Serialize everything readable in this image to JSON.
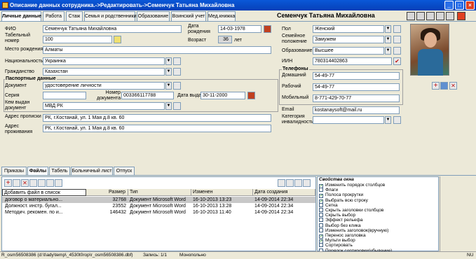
{
  "window": {
    "title": "Описание данных сотрудника.->Редактировать->Семенчук Татьяна Михайловна",
    "controls": [
      "_",
      "□",
      "×"
    ]
  },
  "tabs": [
    {
      "label": "Личные данные"
    },
    {
      "label": "Работа"
    },
    {
      "label": "Стаж"
    },
    {
      "label": "Семья и родственники"
    },
    {
      "label": "Образование"
    },
    {
      "label": "Воинский учет"
    },
    {
      "label": "Мед.книжка"
    }
  ],
  "header_name": "Семенчук Татьяна Михайловна",
  "form": {
    "fio_label": "ФИО",
    "fio_value": "Семенчук Татьяна Михайловна",
    "tabnum_label": "Табельный номер",
    "tabnum_value": "100",
    "birthplace_label": "Место рождения",
    "birthplace_value": "Алматы",
    "nationality_label": "Национальность",
    "nationality_value": "Украинка",
    "citizenship_label": "Гражданство",
    "citizenship_value": "Казахстан",
    "birthdate_label": "Дата рождения",
    "birthdate_value": "14-03-1978",
    "age_label": "Возраст",
    "age_value": "36",
    "age_unit": "лет",
    "passport": {
      "title": "Паспортные данные",
      "doc_label": "Документ",
      "doc_value": "удостоверение личности",
      "series_label": "Серия",
      "series_value": "",
      "number_label": "Номер документа",
      "number_value": "003366117788",
      "issue_label": "Дата выдачи",
      "issue_value": "30-11-2000",
      "issuer_label": "Кем выдан документ",
      "issuer_value": "МВД РК"
    },
    "reg_addr_label": "Адрес прописки",
    "reg_addr_value": "РК, г.Костанай, ул. 1 Мая д.8 кв. 60",
    "live_addr_label": "Адрес проживания",
    "live_addr_value": "РК, г.Костанай, ул. 1 Мая д.8 кв. 60",
    "sex_label": "Пол",
    "sex_value": "Женский",
    "marital_label": "Семейное положение",
    "marital_value": "Замужем",
    "education_label": "Образование",
    "education_value": "Высшее",
    "iin_label": "ИИН",
    "iin_value": "780314402863",
    "phones_title": "Телефоны",
    "home_label": "Домашний",
    "home_value": "54-49-77",
    "work_label": "Рабочий",
    "work_value": "54-49-77",
    "mobile_label": "Мобильный",
    "mobile_value": "8-771-429-70-77",
    "email_label": "Email",
    "email_value": "kostanaysoft@mail.ru",
    "disability_label": "Категория инвалидности",
    "disability_value": ""
  },
  "bottom_tabs": [
    {
      "label": "Приказы"
    },
    {
      "label": "Файлы"
    },
    {
      "label": "Табель"
    },
    {
      "label": "Больничный лист"
    },
    {
      "label": "Отпуск"
    }
  ],
  "files": {
    "add_label": "Добавить файл в список",
    "columns": [
      "Размер",
      "Тип",
      "Изменен",
      "Дата создания"
    ],
    "rows": [
      {
        "name": "договор о материально...",
        "size": "32768",
        "type": "Документ Microsoft Word",
        "modified": "16-10-2013 13:23",
        "created": "14-09-2014 22:34"
      },
      {
        "name": "Должност. инстр. бугал...",
        "size": "23552",
        "type": "Документ Microsoft Word",
        "modified": "16-10-2013 13:28",
        "created": "14-09-2014 22:34"
      },
      {
        "name": "Методич. рекомен. по и...",
        "size": "146432",
        "type": "Документ Microsoft Word",
        "modified": "16-10-2013 11:40",
        "created": "14-09-2014 22:34"
      }
    ]
  },
  "props": {
    "title": "Свойства окна",
    "items": [
      {
        "label": "Изменить порядок столбцов",
        "checked": true
      },
      {
        "label": "Флаги",
        "checked": false
      },
      {
        "label": "Полоса прокрутки",
        "checked": true
      },
      {
        "label": "Выбрать всю строку",
        "checked": true
      },
      {
        "label": "Сетка",
        "checked": false
      },
      {
        "label": "Скрыть заголовки столбцов",
        "checked": false
      },
      {
        "label": "Скрыть выбор",
        "checked": false
      },
      {
        "label": "Эффект рельефа",
        "checked": false
      },
      {
        "label": "Выбор без клика",
        "checked": false
      },
      {
        "label": "Изменить заголовок(вручную)",
        "checked": false
      },
      {
        "label": "Перенос заголовка",
        "checked": true
      },
      {
        "label": "Мульти выбор",
        "checked": true
      },
      {
        "label": "Сортировать",
        "checked": false
      },
      {
        "label": "Порядок сортировки(убывание)",
        "checked": false
      }
    ]
  },
  "status": {
    "path": "R_osm56508386 (d:\\t\\ady\\temp\\_4530t0rop\\r_osm56508386.dbf)",
    "record": "Запись: 1/1",
    "mode": "Монопольно",
    "right": "NU"
  }
}
